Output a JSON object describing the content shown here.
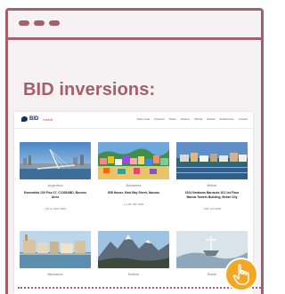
{
  "window": {
    "title_bar_icon": "three-dots-icon"
  },
  "heading": "BID inversions:",
  "site": {
    "logo": {
      "brand": "BID",
      "suffix": "Invest"
    },
    "nav_links": [
      "Sobre Invest",
      "Proyectos",
      "Países",
      "Sectores",
      "Oficinas",
      "Noticias",
      "Publicaciones",
      "Contacto"
    ]
  },
  "cards": [
    {
      "country": "Argentina",
      "address": "Esmeralda 130 Piso 17, C1035ABD, Buenos Aires",
      "phone": "+54 11 4320 1800"
    },
    {
      "country": "Bahamas",
      "address": "IDB House, East Bay Street, Nassau",
      "phone": "+1 242 396 7800"
    },
    {
      "country": "Belize",
      "address": "1024 Newtown Barracks 101 1st Floor Marina Towers Building, Belize City",
      "phone": "+501 223 3900"
    },
    {
      "country": "Barbados"
    },
    {
      "country": "Bolivia"
    },
    {
      "country": "Brazil"
    }
  ],
  "colors": {
    "accent": "#a3606b",
    "cursor": "#f5a623"
  },
  "cursor_icon": "pointing-hand-icon"
}
